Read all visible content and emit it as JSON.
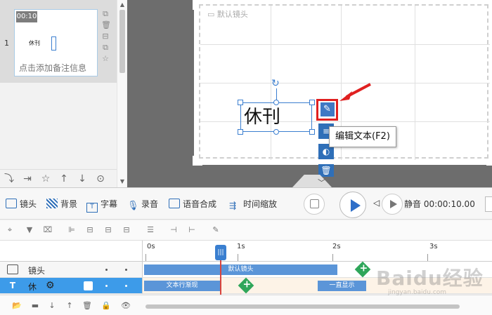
{
  "slide_panel": {
    "slide_number": "1",
    "thumb_time": "00:10",
    "thumb_text": "休刊",
    "thumb_note": "点击添加备注信息"
  },
  "canvas": {
    "frame_label": "默认镜头",
    "text_content": "休刊",
    "tooltip": "编辑文本(F2)",
    "icons": [
      "edit-text",
      "align",
      "animation",
      "delete"
    ]
  },
  "toolbar": {
    "camera": "镜头",
    "background": "背景",
    "subtitle": "字幕",
    "record": "录音",
    "tts": "语音合成",
    "time_zoom": "时间缩放",
    "mute": "静音",
    "time": "00:00:10.00"
  },
  "timeline": {
    "ticks": [
      "0s",
      "1s",
      "2s",
      "3s"
    ],
    "tracks": [
      {
        "label": "镜头",
        "clip": "默认镜头"
      },
      {
        "label": "休",
        "clip_in": "文本行渐现",
        "clip_out": "一直显示"
      }
    ]
  },
  "watermark": {
    "main": "Baidu经验",
    "sub": "jingyan.baidu.com"
  },
  "colors": {
    "accent": "#3a7fd0",
    "highlight": "#e02020",
    "selected_track": "#3d9be9",
    "add": "#2fa65a"
  }
}
